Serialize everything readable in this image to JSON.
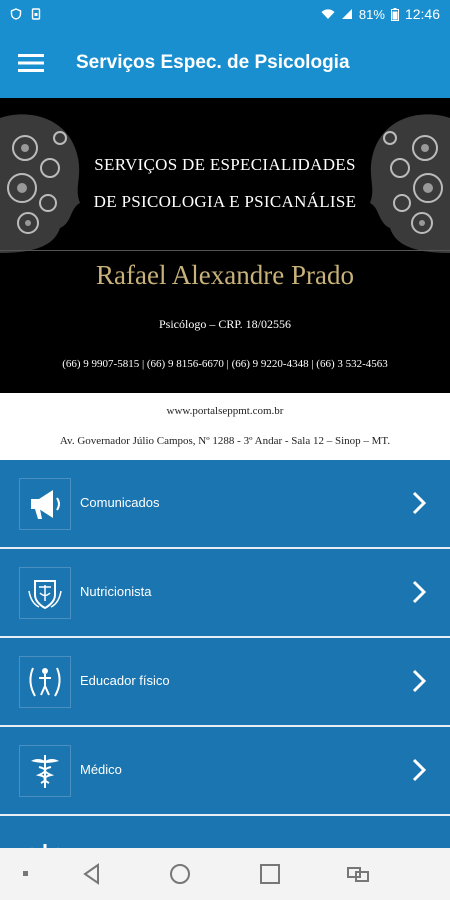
{
  "status_bar": {
    "battery": "81%",
    "time": "12:46"
  },
  "app_bar": {
    "title": "Serviços Espec. de Psicologia"
  },
  "banner": {
    "heading_line1": "SERVIÇOS DE ESPECIALIDADES",
    "heading_line2": "DE PSICOLOGIA E PSICANÁLISE",
    "name": "Rafael Alexandre Prado",
    "crp": "Psicólogo – CRP. 18/02556",
    "phones": "(66) 9 9907-5815  |  (66) 9 8156-6670  |  (66) 9 9220-4348  |  (66) 3 532-4563"
  },
  "address": {
    "website": "www.portalseppmt.com.br",
    "street": "Av. Governador Júlio Campos, Nº 1288 - 3º Andar - Sala 12 – Sinop – MT."
  },
  "menu": [
    {
      "label": "Comunicados",
      "icon": "megaphone-icon"
    },
    {
      "label": "Nutricionista",
      "icon": "nutrition-emblem-icon"
    },
    {
      "label": "Educador físico",
      "icon": "fitness-emblem-icon"
    },
    {
      "label": "Médico",
      "icon": "caduceus-icon"
    },
    {
      "label": "",
      "icon": "psi-icon"
    }
  ],
  "colors": {
    "primary": "#1a8fd0",
    "list_bg": "#1a75b0",
    "divider": "#e8eef3",
    "name_gold": "#c8b27a"
  }
}
